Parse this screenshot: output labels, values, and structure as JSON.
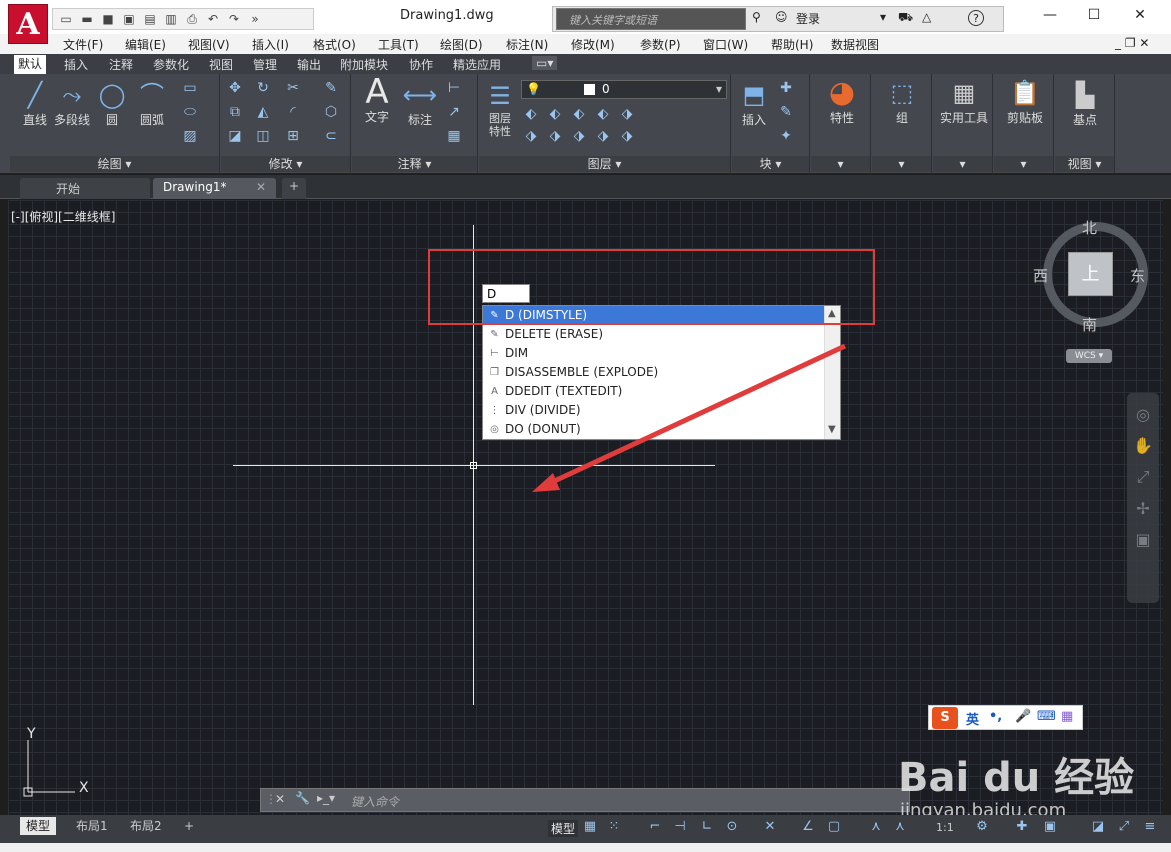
{
  "titlebar": {
    "logo": "A",
    "doc_title": "Drawing1.dwg",
    "search_placeholder": "键入关键字或短语",
    "login": "登录",
    "help": "?"
  },
  "menu": [
    "文件(F)",
    "编辑(E)",
    "视图(V)",
    "插入(I)",
    "格式(O)",
    "工具(T)",
    "绘图(D)",
    "标注(N)",
    "修改(M)",
    "参数(P)",
    "窗口(W)",
    "帮助(H)",
    "数据视图"
  ],
  "ribbon_tabs": [
    "默认",
    "插入",
    "注释",
    "参数化",
    "视图",
    "管理",
    "输出",
    "附加模块",
    "协作",
    "精选应用"
  ],
  "ribbon": {
    "draw_panel": "绘图",
    "line": "直线",
    "polyline": "多段线",
    "circle": "圆",
    "arc": "圆弧",
    "modify_panel": "修改",
    "annotate_panel": "注释",
    "text": "文字",
    "dim": "标注",
    "layer_panel": "图层",
    "layer_props": "图层\n特性",
    "layer_value": "0",
    "block_panel": "块",
    "insert": "插入",
    "properties": "特性",
    "group": "组",
    "utilities": "实用工具",
    "clipboard": "剪贴板",
    "base": "基点",
    "view_panel": "视图"
  },
  "doc_tabs": [
    "开始",
    "Drawing1*"
  ],
  "viewport_label": "[-][俯视][二维线框]",
  "viewcube": {
    "north": "北",
    "south": "南",
    "east": "东",
    "west": "西",
    "face": "上",
    "wcs": "WCS"
  },
  "dynamic_input": "D",
  "autocomplete": [
    {
      "label": "D (DIMSTYLE)",
      "selected": true
    },
    {
      "label": "DELETE (ERASE)"
    },
    {
      "label": "DIM"
    },
    {
      "label": "DISASSEMBLE (EXPLODE)"
    },
    {
      "label": "DDEDIT (TEXTEDIT)"
    },
    {
      "label": "DIV (DIVIDE)"
    },
    {
      "label": "DO (DONUT)"
    }
  ],
  "ucs": {
    "x": "X",
    "y": "Y"
  },
  "command_placeholder": "键入命令",
  "ime": {
    "label": "英"
  },
  "watermark": {
    "main": "Bai du 经验",
    "url": "jingyan.baidu.com"
  },
  "layout_tabs": [
    "模型",
    "布局1",
    "布局2"
  ],
  "status": {
    "model": "模型",
    "scale": "1:1"
  },
  "colors": {
    "accent": "#3b78d8",
    "annotation": "#e03c3c",
    "autocad_red": "#c8102e"
  }
}
